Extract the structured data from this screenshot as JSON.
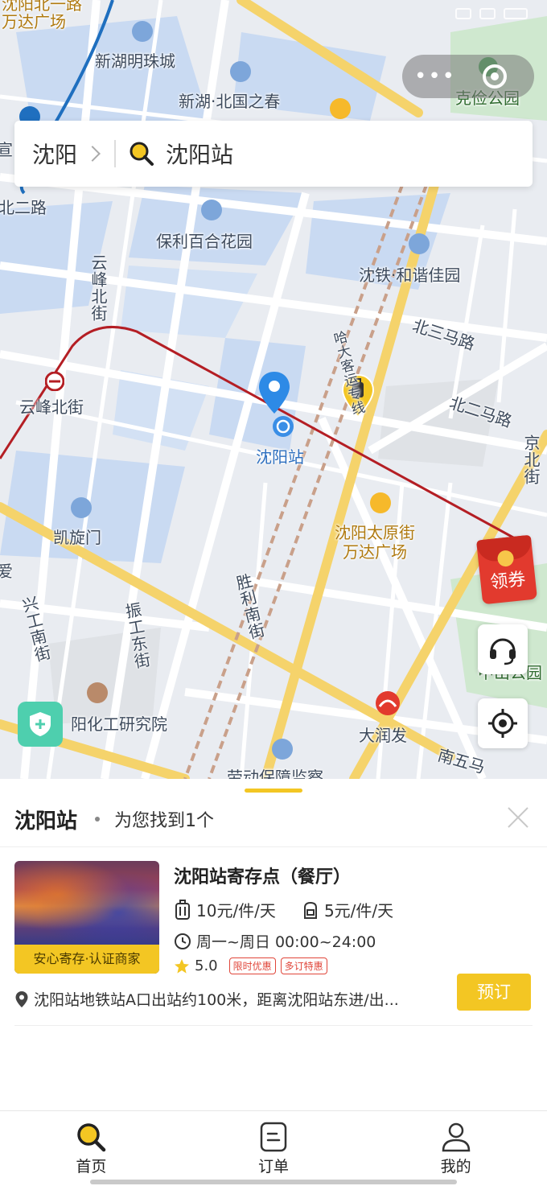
{
  "map": {
    "labels": {
      "top_left": "沈阳北一路\n万达广场",
      "xinhu_mingzhu": "新湖明珠城",
      "xinhu_beiguo": "新湖·北国之春",
      "kejian_park": "克俭公园",
      "xuan": "宣",
      "bei_er_lu_left": "北二路",
      "baoli": "保利百合花园",
      "shentie": "沈铁·和谐佳园",
      "yunfeng_bei_jie_road": "云峰北街",
      "bei_san_ma_lu": "北三马路",
      "ha_da_line": "哈大客运专线",
      "yunfeng_station": "云峰北街",
      "bei_er_ma_lu": "北二马路",
      "jing_bei_jie": "京北街",
      "shenyang_station": "沈阳站",
      "kaixuanmen": "凯旋门",
      "wanda_taiyuan": "沈阳太原街\n万达广场",
      "shengli_nan_jie": "胜利南街",
      "xinggong_nan_jie": "兴工南街",
      "zhengong_dong_jie": "振工东街",
      "huagong": "阳化工研究院",
      "zhongshan_park": "中山公园",
      "da_run_fa": "大润发",
      "nan_wu_ma": "南五马",
      "laodong": "劳动保障监察",
      "ai": "爱"
    }
  },
  "capsule": {
    "more": "•••"
  },
  "search": {
    "city": "沈阳",
    "query": "沈阳站"
  },
  "coupon": {
    "label": "领券"
  },
  "sheet": {
    "title": "沈阳站",
    "count_text": "为您找到1个"
  },
  "result": {
    "name": "沈阳站寄存点（餐厅）",
    "badge": "安心寄存·认证商家",
    "price_big": "10元/件/天",
    "price_small": "5元/件/天",
    "hours": "周一~周日 00:00~24:00",
    "rating": "5.0",
    "tags": [
      "限时优惠",
      "多订特惠"
    ],
    "address": "沈阳站地铁站A口出站约100米，距离沈阳站东进/出...",
    "book_label": "预订"
  },
  "tabs": [
    {
      "label": "首页",
      "icon": "search-icon"
    },
    {
      "label": "订单",
      "icon": "order-icon"
    },
    {
      "label": "我的",
      "icon": "user-icon"
    }
  ],
  "colors": {
    "accent": "#f3c623",
    "metro_line": "#b41e24",
    "tag_red": "#e0463a"
  }
}
